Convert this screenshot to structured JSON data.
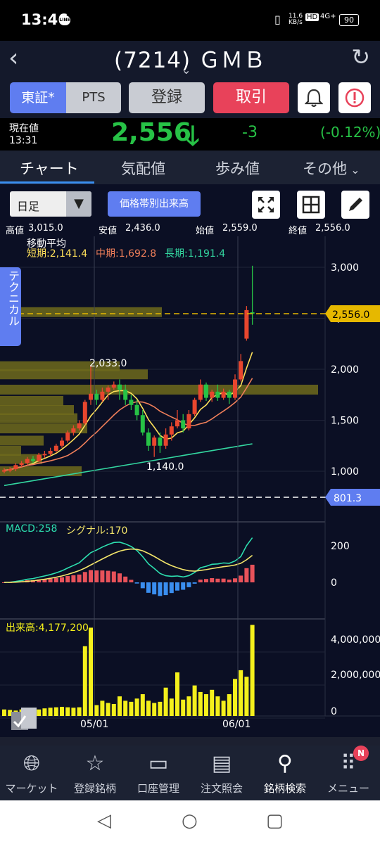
{
  "status": {
    "time": "13:46",
    "line_badge": "LINE",
    "net_speed": "11.6 KB/s",
    "signal": "4G+",
    "battery": "90"
  },
  "header": {
    "title": "(7214) ＧＭＢ"
  },
  "buttons": {
    "tosho": "東証*",
    "pts": "PTS",
    "register": "登録",
    "trade": "取引"
  },
  "quote": {
    "label": "現在値",
    "time": "13:31",
    "price": "2,556",
    "change": "-3",
    "change_pct": "(-0.12%)",
    "color": "#27c246"
  },
  "tabs": {
    "chart": "チャート",
    "kehai": "気配値",
    "ayumi": "歩み値",
    "other": "その他"
  },
  "toolbar": {
    "period": "日足",
    "volume_profile": "価格帯別出来高"
  },
  "ohlc": {
    "high_label": "高値",
    "high": "3,015.0",
    "low_label": "安値",
    "low": "2,436.0",
    "open_label": "始値",
    "open": "2,559.0",
    "close_label": "終値",
    "close": "2,556.0"
  },
  "side_tab": "テクニカル",
  "chart_data": {
    "type": "candlestick",
    "ma_title": "移動平均",
    "ma_short": "短期:2,141.4",
    "ma_mid": "中期:1,692.8",
    "ma_long": "長期:1,191.4",
    "price_ticks": [
      "3,000",
      "2,500",
      "2,000",
      "1,500",
      "1,000"
    ],
    "current_price_tag": "2,556.0",
    "lower_tag": "801.3",
    "annotation_high": "2,033.0",
    "annotation_low": "1,140.0",
    "date_labels": [
      "05/01",
      "06/01"
    ],
    "candles": [
      {
        "o": 1000,
        "c": 1010,
        "h": 1030,
        "l": 980
      },
      {
        "o": 1010,
        "c": 1020,
        "h": 1040,
        "l": 990
      },
      {
        "o": 1020,
        "c": 1060,
        "h": 1080,
        "l": 1000
      },
      {
        "o": 1060,
        "c": 1080,
        "h": 1100,
        "l": 1040
      },
      {
        "o": 1080,
        "c": 1120,
        "h": 1140,
        "l": 1060
      },
      {
        "o": 1120,
        "c": 1100,
        "h": 1150,
        "l": 1080
      },
      {
        "o": 1100,
        "c": 1160,
        "h": 1180,
        "l": 1090
      },
      {
        "o": 1160,
        "c": 1170,
        "h": 1200,
        "l": 1130
      },
      {
        "o": 1170,
        "c": 1200,
        "h": 1230,
        "l": 1150
      },
      {
        "o": 1200,
        "c": 1250,
        "h": 1270,
        "l": 1180
      },
      {
        "o": 1250,
        "c": 1300,
        "h": 1330,
        "l": 1230
      },
      {
        "o": 1300,
        "c": 1380,
        "h": 1400,
        "l": 1280
      },
      {
        "o": 1380,
        "c": 1420,
        "h": 1450,
        "l": 1350
      },
      {
        "o": 1420,
        "c": 1470,
        "h": 1500,
        "l": 1400
      },
      {
        "o": 1470,
        "c": 1680,
        "h": 1700,
        "l": 1450
      },
      {
        "o": 1700,
        "c": 1760,
        "h": 2033,
        "l": 1650
      },
      {
        "o": 1760,
        "c": 1700,
        "h": 1800,
        "l": 1650
      },
      {
        "o": 1700,
        "c": 1780,
        "h": 1820,
        "l": 1680
      },
      {
        "o": 1780,
        "c": 1820,
        "h": 1840,
        "l": 1700
      },
      {
        "o": 1820,
        "c": 1850,
        "h": 1880,
        "l": 1800
      },
      {
        "o": 1850,
        "c": 1800,
        "h": 1900,
        "l": 1700
      },
      {
        "o": 1800,
        "c": 1700,
        "h": 1850,
        "l": 1650
      },
      {
        "o": 1700,
        "c": 1650,
        "h": 1750,
        "l": 1600
      },
      {
        "o": 1650,
        "c": 1550,
        "h": 1700,
        "l": 1500
      },
      {
        "o": 1550,
        "c": 1380,
        "h": 1600,
        "l": 1350
      },
      {
        "o": 1380,
        "c": 1250,
        "h": 1420,
        "l": 1200
      },
      {
        "o": 1250,
        "c": 1330,
        "h": 1350,
        "l": 1140
      },
      {
        "o": 1330,
        "c": 1250,
        "h": 1380,
        "l": 1180
      },
      {
        "o": 1250,
        "c": 1360,
        "h": 1420,
        "l": 1220
      },
      {
        "o": 1360,
        "c": 1440,
        "h": 1480,
        "l": 1300
      },
      {
        "o": 1440,
        "c": 1500,
        "h": 1600,
        "l": 1420
      },
      {
        "o": 1500,
        "c": 1420,
        "h": 1560,
        "l": 1380
      },
      {
        "o": 1420,
        "c": 1560,
        "h": 1600,
        "l": 1400
      },
      {
        "o": 1560,
        "c": 1700,
        "h": 1720,
        "l": 1540
      },
      {
        "o": 1700,
        "c": 1850,
        "h": 1900,
        "l": 1680
      },
      {
        "o": 1850,
        "c": 1720,
        "h": 1870,
        "l": 1690
      },
      {
        "o": 1720,
        "c": 1780,
        "h": 1800,
        "l": 1680
      },
      {
        "o": 1780,
        "c": 1720,
        "h": 1850,
        "l": 1690
      },
      {
        "o": 1720,
        "c": 1780,
        "h": 1810,
        "l": 1700
      },
      {
        "o": 1780,
        "c": 1720,
        "h": 1800,
        "l": 1660
      },
      {
        "o": 1720,
        "c": 1900,
        "h": 1950,
        "l": 1700
      },
      {
        "o": 1900,
        "c": 2080,
        "h": 2150,
        "l": 1880
      },
      {
        "o": 2300,
        "c": 2580,
        "h": 2620,
        "l": 2280
      },
      {
        "o": 2559,
        "c": 2556,
        "h": 3015,
        "l": 2436
      }
    ],
    "macd_label": "MACD:258",
    "signal_label": "シグナル:170",
    "macd_ticks": [
      "200",
      "0"
    ],
    "volume_label": "出来高:4,177,200",
    "volume_ticks": [
      "4,000,000",
      "2,000,000",
      "0"
    ],
    "volumes": [
      300000,
      280000,
      250000,
      300000,
      350000,
      320000,
      300000,
      350000,
      380000,
      400000,
      420000,
      400000,
      380000,
      400000,
      3200000,
      4050000,
      500000,
      700000,
      600000,
      550000,
      900000,
      700000,
      650000,
      800000,
      1000000,
      700000,
      600000,
      650000,
      1300000,
      800000,
      2000000,
      750000,
      900000,
      1400000,
      1100000,
      1000000,
      1200000,
      900000,
      700000,
      1000000,
      1700000,
      2100000,
      1800000,
      4177200
    ],
    "colors": {
      "up": "#e8462e",
      "down": "#27c246",
      "ma_short": "#ffe15a",
      "ma_mid": "#f07f5a",
      "ma_long": "#33d6a0",
      "volume": "#f4f01c",
      "macd": "#2de0b0",
      "signal": "#f3e56a",
      "hist_up": "#e8525a",
      "hist_down": "#3a8ef0",
      "band": "#6e6a1c"
    }
  },
  "nav": [
    {
      "label": "マーケット"
    },
    {
      "label": "登録銘柄"
    },
    {
      "label": "口座管理"
    },
    {
      "label": "注文照会"
    },
    {
      "label": "銘柄検索"
    },
    {
      "label": "メニュー"
    }
  ],
  "nav_badge": "N"
}
